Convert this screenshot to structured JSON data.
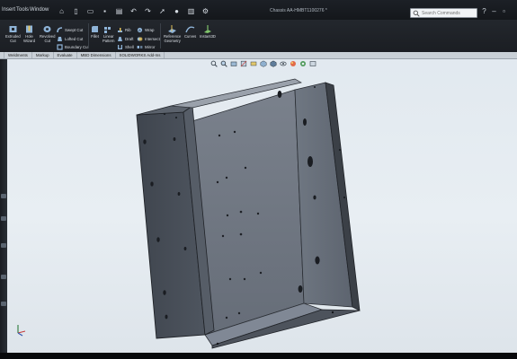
{
  "menu": {
    "items": [
      "Insert",
      "Tools",
      "Window"
    ]
  },
  "title": {
    "document": "Chassis AA-HMBT1100276 *"
  },
  "search": {
    "placeholder": "Search Commands"
  },
  "quick_access": {
    "icons": [
      "home-icon",
      "new-file-icon",
      "open-icon",
      "save-icon",
      "print-icon",
      "undo-icon",
      "redo-icon",
      "select-icon",
      "rebuild-icon",
      "file-properties-icon",
      "options-icon"
    ]
  },
  "ribbon": {
    "extruded_cut": "Extruded\nCut",
    "hole_wizard": "Hole\nWizard",
    "revolved_cut": "Revolved\nCut",
    "swept_cut": "Swept Cut",
    "lofted_cut": "Lofted Cut",
    "boundary_cut": "Boundary Cut",
    "fillet": "Fillet",
    "linear_pattern": "Linear\nPattern",
    "rib": "Rib",
    "draft": "Draft",
    "shell": "Shell",
    "wrap": "Wrap",
    "intersect": "Intersect",
    "mirror": "Mirror",
    "reference_geometry": "Reference\nGeometry",
    "curves": "Curves",
    "instant3d": "Instant3D"
  },
  "tabs": [
    "Weldments",
    "Markup",
    "Evaluate",
    "MBD Dimensions",
    "SOLIDWORKS Add-Ins"
  ],
  "hud": {
    "icons": [
      "zoom-to-fit-icon",
      "zoom-to-area-icon",
      "previous-view-icon",
      "section-view-icon",
      "dynamic-annotation-icon",
      "view-orientation-icon",
      "display-style-icon",
      "hide-show-icon",
      "edit-appearance-icon",
      "apply-scene-icon",
      "view-settings-icon"
    ]
  },
  "colors": {
    "title_bar": "#1c2026",
    "ribbon": "#23272d",
    "viewport_top": "#dfe7ee",
    "model_face_light": "#6d7581",
    "model_face_dark": "#454b55",
    "model_edge": "#1f2227"
  }
}
